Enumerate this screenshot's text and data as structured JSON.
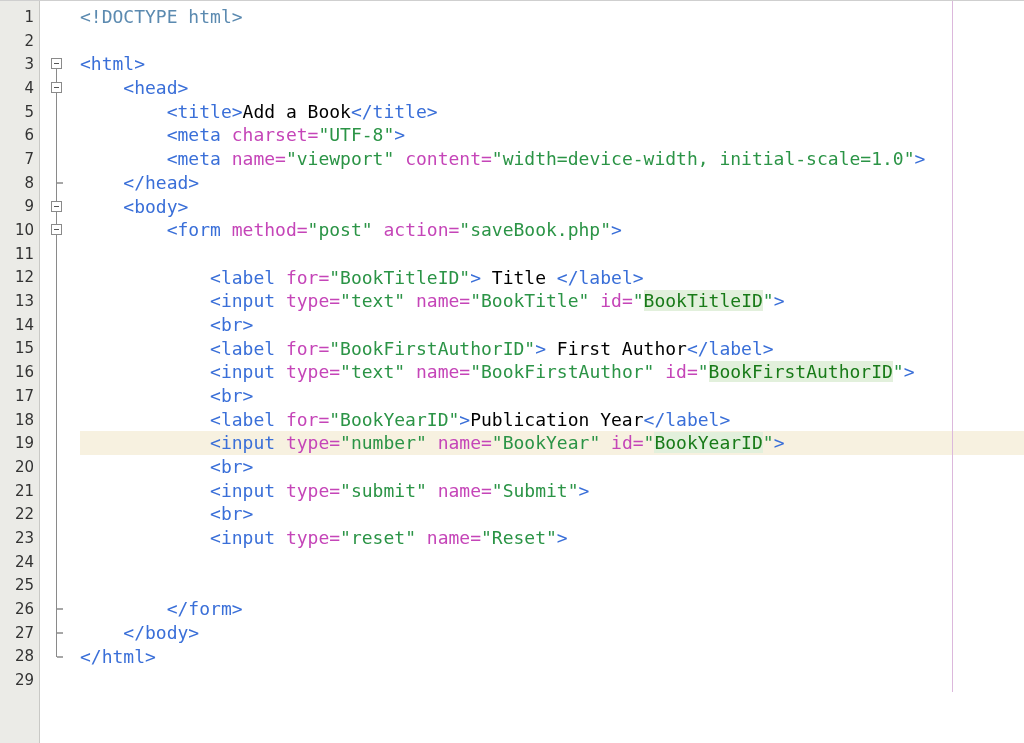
{
  "editor": {
    "lines": [
      {
        "number": "1",
        "current": false,
        "kind": "plain",
        "tokens": [
          {
            "kind": "doctype",
            "text": "<!DOCTYPE html>"
          }
        ]
      },
      {
        "number": "2",
        "current": false,
        "kind": "plain"
      },
      {
        "number": "3",
        "current": false,
        "kind": "fold_start",
        "tokens": [
          {
            "kind": "tag",
            "text": "<html>"
          }
        ]
      },
      {
        "number": "4",
        "current": false,
        "kind": "fold_start",
        "tokens": [
          {
            "kind": "tag",
            "text": "    <head>"
          }
        ]
      },
      {
        "number": "5",
        "current": false,
        "kind": "plain",
        "tokens": [
          {
            "kind": "tag",
            "text": "        <title>"
          },
          {
            "kind": "text",
            "text": "Add a Book"
          },
          {
            "kind": "tag",
            "text": "</title>"
          }
        ]
      },
      {
        "number": "6",
        "current": false,
        "kind": "plain",
        "tokens": [
          {
            "kind": "tag",
            "text": "        <meta"
          },
          {
            "kind": "attr",
            "text": " charset="
          },
          {
            "kind": "string",
            "text": "\"UTF-8\""
          },
          {
            "kind": "tag",
            "text": ">"
          }
        ]
      },
      {
        "number": "7",
        "current": false,
        "kind": "plain",
        "tokens": [
          {
            "kind": "tag",
            "text": "        <meta"
          },
          {
            "kind": "attr",
            "text": " name="
          },
          {
            "kind": "string",
            "text": "\"viewport\""
          },
          {
            "kind": "attr",
            "text": " content="
          },
          {
            "kind": "string",
            "text": "\"width=device-width, initial-scale=1.0\""
          },
          {
            "kind": "tag",
            "text": ">"
          }
        ]
      },
      {
        "number": "8",
        "current": false,
        "kind": "fold_end",
        "tokens": [
          {
            "kind": "tag",
            "text": "    </head>"
          }
        ]
      },
      {
        "number": "9",
        "current": false,
        "kind": "fold_start",
        "tokens": [
          {
            "kind": "tag",
            "text": "    <body>"
          }
        ]
      },
      {
        "number": "10",
        "current": false,
        "kind": "fold_start",
        "tokens": [
          {
            "kind": "tag",
            "text": "        <form"
          },
          {
            "kind": "attr",
            "text": " method="
          },
          {
            "kind": "string",
            "text": "\"post\""
          },
          {
            "kind": "attr",
            "text": " action="
          },
          {
            "kind": "string",
            "text": "\"saveBook.php\""
          },
          {
            "kind": "tag",
            "text": ">"
          }
        ]
      },
      {
        "number": "11",
        "current": false,
        "kind": "plain"
      },
      {
        "number": "12",
        "current": false,
        "kind": "plain",
        "tokens": [
          {
            "kind": "tag",
            "text": "            <label"
          },
          {
            "kind": "attr",
            "text": " for="
          },
          {
            "kind": "string",
            "text": "\"BookTitleID\""
          },
          {
            "kind": "tag",
            "text": ">"
          },
          {
            "kind": "text",
            "text": " Title "
          },
          {
            "kind": "tag",
            "text": "</label>"
          }
        ]
      },
      {
        "number": "13",
        "current": false,
        "kind": "plain",
        "tokens": [
          {
            "kind": "tag",
            "text": "            <input"
          },
          {
            "kind": "attr",
            "text": " type="
          },
          {
            "kind": "string",
            "text": "\"text\""
          },
          {
            "kind": "attr",
            "text": " name="
          },
          {
            "kind": "string",
            "text": "\"BookTitle\""
          },
          {
            "kind": "attr",
            "text": " id="
          },
          {
            "kind": "string",
            "text": "\""
          },
          {
            "kind": "match",
            "text": "BookTitleID"
          },
          {
            "kind": "string",
            "text": "\""
          },
          {
            "kind": "tag",
            "text": ">"
          }
        ]
      },
      {
        "number": "14",
        "current": false,
        "kind": "plain",
        "tokens": [
          {
            "kind": "tag",
            "text": "            <br>"
          }
        ]
      },
      {
        "number": "15",
        "current": false,
        "kind": "plain",
        "tokens": [
          {
            "kind": "tag",
            "text": "            <label"
          },
          {
            "kind": "attr",
            "text": " for="
          },
          {
            "kind": "string",
            "text": "\"BookFirstAuthorID\""
          },
          {
            "kind": "tag",
            "text": ">"
          },
          {
            "kind": "text",
            "text": " First Author"
          },
          {
            "kind": "tag",
            "text": "</label>"
          }
        ]
      },
      {
        "number": "16",
        "current": false,
        "kind": "plain",
        "tokens": [
          {
            "kind": "tag",
            "text": "            <input"
          },
          {
            "kind": "attr",
            "text": " type="
          },
          {
            "kind": "string",
            "text": "\"text\""
          },
          {
            "kind": "attr",
            "text": " name="
          },
          {
            "kind": "string",
            "text": "\"BookFirstAuthor\""
          },
          {
            "kind": "attr",
            "text": " id="
          },
          {
            "kind": "string",
            "text": "\""
          },
          {
            "kind": "match",
            "text": "BookFirstAuthorID"
          },
          {
            "kind": "string",
            "text": "\""
          },
          {
            "kind": "tag",
            "text": ">"
          }
        ]
      },
      {
        "number": "17",
        "current": false,
        "kind": "plain",
        "tokens": [
          {
            "kind": "tag",
            "text": "            <br>"
          }
        ]
      },
      {
        "number": "18",
        "current": false,
        "kind": "plain",
        "tokens": [
          {
            "kind": "tag",
            "text": "            <label"
          },
          {
            "kind": "attr",
            "text": " for="
          },
          {
            "kind": "string",
            "text": "\"BookYearID\""
          },
          {
            "kind": "tag",
            "text": ">"
          },
          {
            "kind": "text",
            "text": "Publication Year"
          },
          {
            "kind": "tag",
            "text": "</label>"
          }
        ]
      },
      {
        "number": "19",
        "current": true,
        "kind": "plain",
        "tokens": [
          {
            "kind": "tag",
            "text": "            <input"
          },
          {
            "kind": "attr",
            "text": " type="
          },
          {
            "kind": "string",
            "text": "\"number\""
          },
          {
            "kind": "attr",
            "text": " name="
          },
          {
            "kind": "string",
            "text": "\"BookYear\""
          },
          {
            "kind": "attr",
            "text": " id="
          },
          {
            "kind": "string",
            "text": "\""
          },
          {
            "kind": "match",
            "text": "BookYearID"
          },
          {
            "kind": "string",
            "text": "\""
          },
          {
            "kind": "tag",
            "text": ">"
          }
        ]
      },
      {
        "number": "20",
        "current": false,
        "kind": "plain",
        "tokens": [
          {
            "kind": "tag",
            "text": "            <br>"
          }
        ]
      },
      {
        "number": "21",
        "current": false,
        "kind": "plain",
        "tokens": [
          {
            "kind": "tag",
            "text": "            <input"
          },
          {
            "kind": "attr",
            "text": " type="
          },
          {
            "kind": "string",
            "text": "\"submit\""
          },
          {
            "kind": "attr",
            "text": " name="
          },
          {
            "kind": "string",
            "text": "\"Submit\""
          },
          {
            "kind": "tag",
            "text": ">"
          }
        ]
      },
      {
        "number": "22",
        "current": false,
        "kind": "plain",
        "tokens": [
          {
            "kind": "tag",
            "text": "            <br>"
          }
        ]
      },
      {
        "number": "23",
        "current": false,
        "kind": "plain",
        "tokens": [
          {
            "kind": "tag",
            "text": "            <input"
          },
          {
            "kind": "attr",
            "text": " type="
          },
          {
            "kind": "string",
            "text": "\"reset\""
          },
          {
            "kind": "attr",
            "text": " name="
          },
          {
            "kind": "string",
            "text": "\"Reset\""
          },
          {
            "kind": "tag",
            "text": ">"
          }
        ]
      },
      {
        "number": "24",
        "current": false,
        "kind": "plain"
      },
      {
        "number": "25",
        "current": false,
        "kind": "plain"
      },
      {
        "number": "26",
        "current": false,
        "kind": "fold_end",
        "tokens": [
          {
            "kind": "tag",
            "text": "        </form>"
          }
        ]
      },
      {
        "number": "27",
        "current": false,
        "kind": "fold_end",
        "tokens": [
          {
            "kind": "tag",
            "text": "    </body>"
          }
        ]
      },
      {
        "number": "28",
        "current": false,
        "kind": "fold_last",
        "tokens": [
          {
            "kind": "tag",
            "text": "</html>"
          }
        ]
      },
      {
        "number": "29",
        "current": false,
        "kind": "plain"
      }
    ]
  }
}
